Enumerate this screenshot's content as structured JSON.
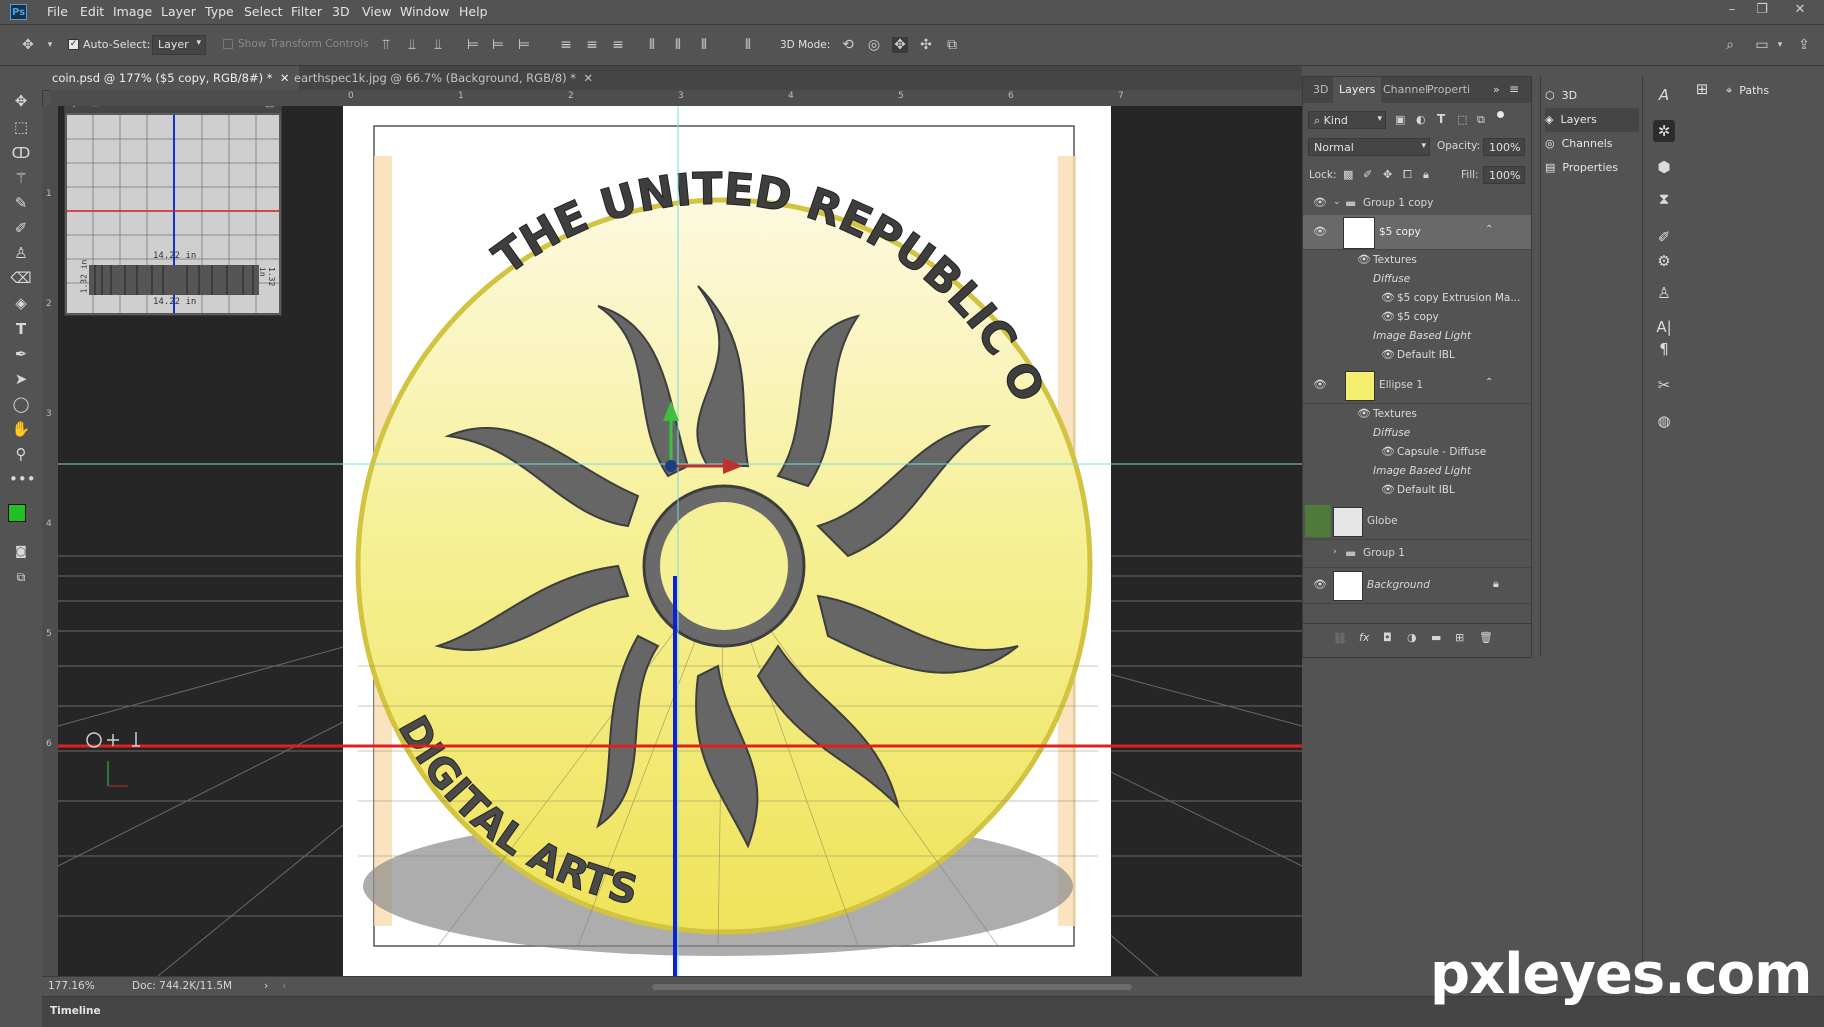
{
  "app": {
    "logo": "Ps"
  },
  "menu": [
    "File",
    "Edit",
    "Image",
    "Layer",
    "Type",
    "Select",
    "Filter",
    "3D",
    "View",
    "Window",
    "Help"
  ],
  "options": {
    "auto_select_label": "Auto-Select:",
    "auto_select_checked": true,
    "auto_select_target": "Layer",
    "show_transform_label": "Show Transform Controls",
    "mode_label": "3D Mode:"
  },
  "tabs": [
    {
      "label": "coin.psd @ 177% ($5 copy, RGB/8#) *",
      "active": true
    },
    {
      "label": "earthspec1k.jpg @ 66.7% (Background, RGB/8) *",
      "active": false
    }
  ],
  "ruler": {
    "h": [
      "0",
      "1",
      "2",
      "3",
      "4",
      "5",
      "6",
      "7"
    ],
    "v": [
      "1",
      "2",
      "3",
      "4",
      "5",
      "6"
    ]
  },
  "secondary_view": {
    "measure_top": "14.22 in",
    "measure_bottom": "14.22 in",
    "measure_left": "1.32 in",
    "measure_right": "1.32 in"
  },
  "coin": {
    "top_text": "THE UNITED REPUBLIC OF PIXLAND",
    "bottom_text": "DIGITAL ARTS"
  },
  "status": {
    "zoom": "177.16%",
    "doc": "Doc: 744.2K/11.5M"
  },
  "timeline": {
    "label": "Timeline"
  },
  "layers_panel": {
    "tabs": [
      "3D",
      "Layers",
      "Channel",
      "Properti"
    ],
    "active_tab": "Layers",
    "filter": "Kind",
    "blend_mode": "Normal",
    "opacity_label": "Opacity:",
    "opacity": "100%",
    "lock_label": "Lock:",
    "fill_label": "Fill:",
    "fill": "100%",
    "layers": [
      {
        "name": "Group 1 copy",
        "type": "group",
        "visible": true,
        "expanded": true
      },
      {
        "name": "$5 copy",
        "type": "3d",
        "visible": true,
        "selected": true,
        "sub": [
          {
            "text": "Textures",
            "eye": true,
            "indent": 1
          },
          {
            "text": "Diffuse",
            "eye": false,
            "indent": 2,
            "italic": true
          },
          {
            "text": "$5 copy Extrusion Ma...",
            "eye": true,
            "indent": 3
          },
          {
            "text": "$5 copy",
            "eye": true,
            "indent": 3
          },
          {
            "text": "Image Based Light",
            "eye": false,
            "indent": 2,
            "italic": true
          },
          {
            "text": "Default IBL",
            "eye": true,
            "indent": 3
          }
        ]
      },
      {
        "name": "Ellipse 1",
        "type": "3d",
        "visible": true,
        "sub": [
          {
            "text": "Textures",
            "eye": true,
            "indent": 1
          },
          {
            "text": "Diffuse",
            "eye": false,
            "indent": 2,
            "italic": true
          },
          {
            "text": "Capsule - Diffuse",
            "eye": true,
            "indent": 3
          },
          {
            "text": "Image Based Light",
            "eye": false,
            "indent": 2,
            "italic": true
          },
          {
            "text": "Default IBL",
            "eye": true,
            "indent": 3
          }
        ]
      },
      {
        "name": "Globe",
        "type": "layer",
        "visible": false
      },
      {
        "name": "Group 1",
        "type": "group",
        "visible": false,
        "expanded": false
      },
      {
        "name": "Background",
        "type": "background",
        "visible": true,
        "locked": true,
        "italic": true
      }
    ]
  },
  "mini_panel": [
    "3D",
    "Layers",
    "Channels",
    "Properties"
  ],
  "right_panel": {
    "paths_label": "Paths"
  },
  "watermark": "pxleyes.com",
  "colors": {
    "foreground": "#22c022",
    "background": "#ffffff",
    "coin": "#f4ea6a",
    "guide_cyan": "#6ee0e0",
    "guide_red": "#e02020",
    "guide_blue": "#1020d0"
  }
}
